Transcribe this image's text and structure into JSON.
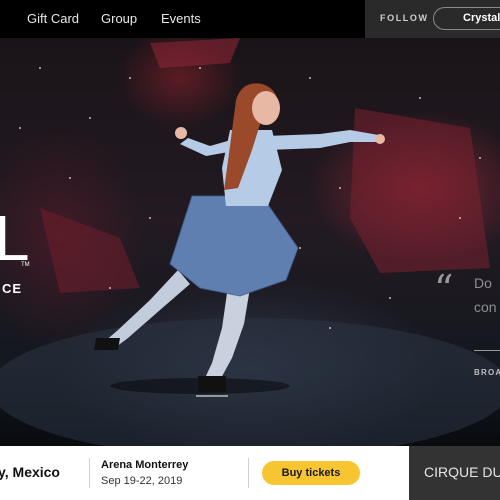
{
  "nav": {
    "links": [
      "Gift Card",
      "Group",
      "Events"
    ],
    "follow_label": "FOLLOW",
    "follow_pill": "Crystal"
  },
  "hero": {
    "logo_fragment": "L",
    "logo_tm": "TM",
    "logo_sub": "CE",
    "quote_mark": "“",
    "quote_line1": "Do",
    "quote_line2": "con",
    "quote_source": "BROA"
  },
  "show": {
    "city": "y, Mexico",
    "venue": "Arena Monterrey",
    "dates": "Sep 19-22, 2019",
    "buy_label": "Buy tickets"
  },
  "brand": {
    "label": "CIRQUE DU"
  },
  "colors": {
    "accent": "#f7c531",
    "topbar": "#000000",
    "follow_bg": "#2a2a2a",
    "brand_bg": "#333333"
  }
}
